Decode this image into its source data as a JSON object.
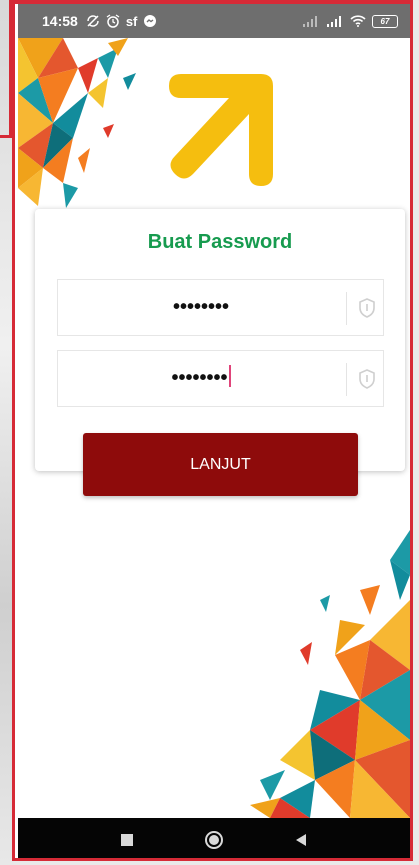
{
  "status_bar": {
    "time": "14:58",
    "carrier_icon_text": "sf",
    "battery_level": "67",
    "icons": [
      "sync-off-icon",
      "alarm-icon",
      "messenger-icon",
      "signal-icon",
      "signal-icon",
      "wifi-icon",
      "battery-icon"
    ]
  },
  "login": {
    "title": "Buat Password",
    "password_value": "••••••••",
    "confirm_password_value": "••••••••",
    "submit_label": "LANJUT"
  },
  "nav": {
    "buttons": [
      "recent-apps-icon",
      "home-icon",
      "back-icon"
    ]
  },
  "colors": {
    "accent_green": "#179b4f",
    "button_red": "#8e0b0b",
    "logo_yellow": "#f5be0f",
    "frame_red": "#d62a36"
  }
}
